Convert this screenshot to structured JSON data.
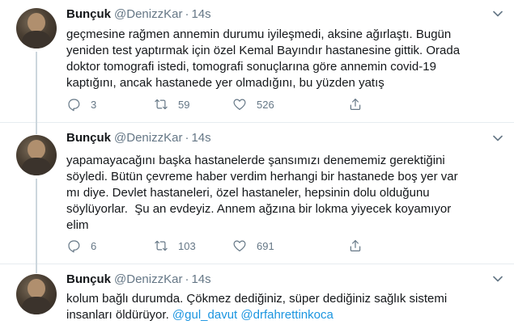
{
  "tweets": [
    {
      "author_name": "Bunçuk",
      "handle": "@DenizzKar",
      "separator": "·",
      "time": "14s",
      "lines": [
        "geçmesine rağmen annemin durumu iyileşmedi, aksine ağırlaştı. Bugün",
        "yeniden test yaptırmak için özel Kemal Bayındır hastanesine gittik. Orada",
        "doktor tomografi istedi, tomografi sonuçlarına göre annemin covid-19",
        "kaptığını, ancak hastanede yer olmadığını, bu yüzden yatış"
      ],
      "replies": "3",
      "retweets": "59",
      "likes": "526"
    },
    {
      "author_name": "Bunçuk",
      "handle": "@DenizzKar",
      "separator": "·",
      "time": "14s",
      "lines": [
        "yapamayacağını başka hastanelerde şansımızı denememiz gerektiğini",
        "söyledi. Bütün çevreme haber verdim herhangi bir hastanede boş yer var",
        "mı diye. Devlet hastaneleri, özel hastaneler, hepsinin dolu olduğunu",
        "söylüyorlar.  Şu an evdeyiz. Annem ağzına bir lokma yiyecek koyamıyor",
        "elim"
      ],
      "replies": "6",
      "retweets": "103",
      "likes": "691"
    },
    {
      "author_name": "Bunçuk",
      "handle": "@DenizzKar",
      "separator": "·",
      "time": "14s",
      "lines": [
        "kolum bağlı durumda. Çökmez dediğiniz, süper dediğiniz sağlık sistemi",
        "insanları öldürüyor."
      ],
      "mentions": [
        "@gul_davut",
        "@drfahrettinkoca"
      ]
    }
  ],
  "icons": {
    "reply": "reply-icon",
    "retweet": "retweet-icon",
    "like": "heart-icon",
    "share": "share-icon",
    "more": "chevron-down-icon"
  },
  "colors": {
    "text": "#14171a",
    "muted": "#657786",
    "link": "#1b95e0",
    "divider": "#e6ecf0",
    "thread": "#ccd6dd"
  }
}
